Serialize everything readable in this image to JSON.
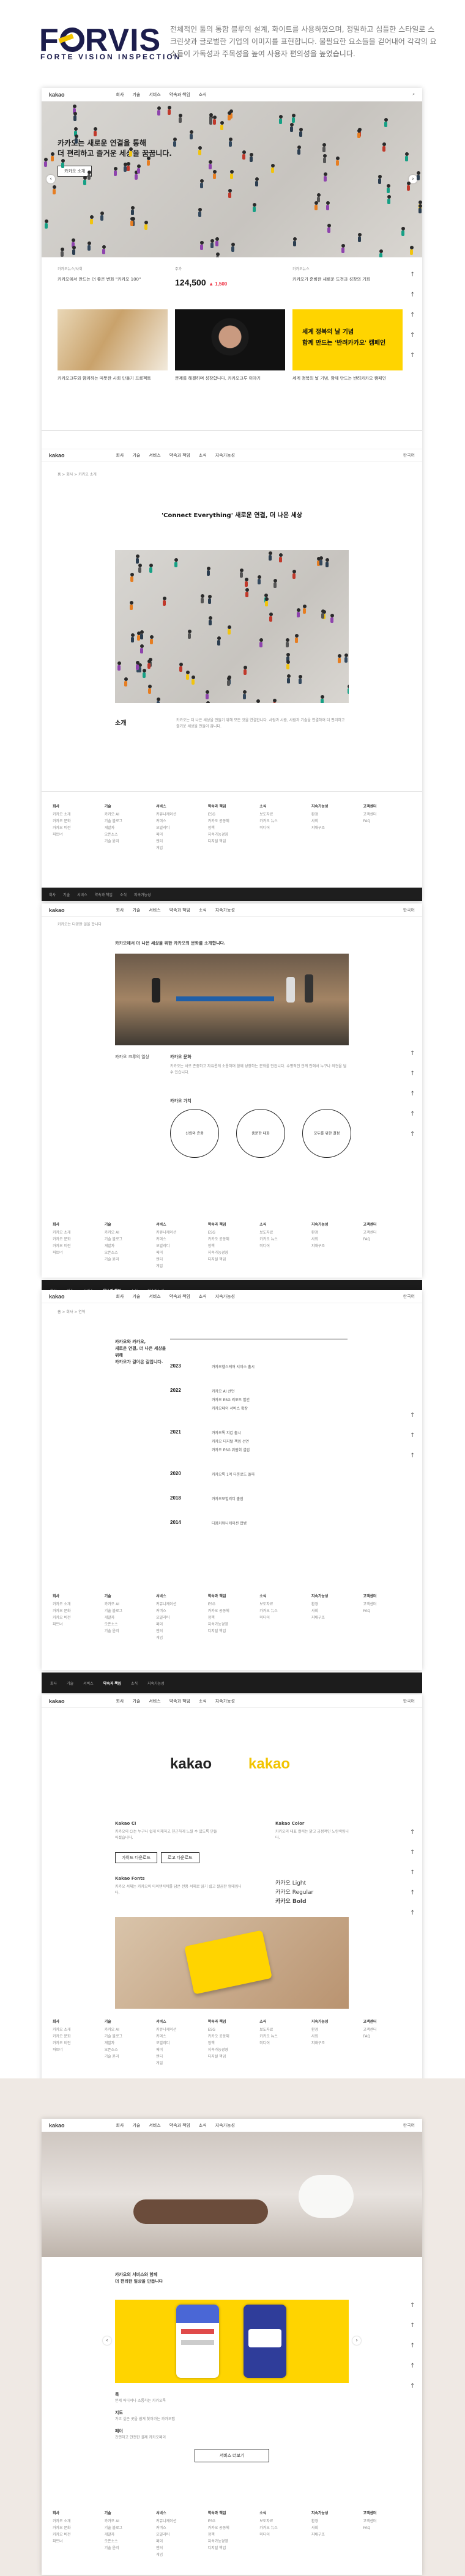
{
  "brand": {
    "name": "FORVIS",
    "tagline": "FORTE VISION INSPECTION"
  },
  "intro": "전체적인 툴의 통합 블루의 설계, 화이트를 사용하였으며, 정밀하고 심플한 스타일로 스크린샷과 글로벌한 기업의 이미지를 표현합니다. 불필요한 요소들을 걷어내어 각각의 요소들이 가독성과 주목성을 높여 사용자 편의성을 높였습니다.",
  "site": {
    "brand": "kakao",
    "nav": [
      "회사",
      "기술",
      "서비스",
      "약속과 책임",
      "소식"
    ],
    "nav_full": [
      "회사",
      "기술",
      "서비스",
      "약속과 책임",
      "소식",
      "지속가능성"
    ],
    "lang": "한국어",
    "hero_lines": [
      "카카오는 새로운 연결을 통해",
      "더 편리하고 즐거운 세상을 꿈꿉니다."
    ],
    "hero_btn": "카카오 소개",
    "news1_label": "카카오뉴스/사회",
    "news1_title": "카카오에서 만드는 더 좋은 변화 \"카카오 100\"",
    "stock_label": "주가",
    "stock_price": "124,500",
    "stock_change": "▲ 1,500",
    "news3_label": "카카오뉴스",
    "news3_title": "카카오가 준비한 새로운 도전과 성장의 기회",
    "yellow_lines": [
      "세계 정복의 날 기념",
      "함께 만드는 '반려카카오' 캠페인"
    ],
    "card_caption_1": "카카오크루와 함께하는 따뜻한 사회 만들기 프로젝트",
    "card_caption_2": "문제를 해결하며 성장합니다, 카카오크루 이야기",
    "card_caption_3": "세계 정복의 날 기념, 함께 만드는 반려카카오 캠페인",
    "side_icons": [
      "↑",
      "↑",
      "↑",
      "↑",
      "↑"
    ]
  },
  "about": {
    "breadcrumb": "홈 > 회사 > 카카오 소개",
    "heading": "'Connect Everything' 새로운 연결, 더 나은 세상",
    "label": "소개",
    "body": "카카오는 더 나은 세상을 만들기 위해 모든 것을 연결합니다. 사람과 사람, 사람과 기술을 연결하여 더 편리하고 즐거운 세상을 만들어 갑니다."
  },
  "footer": {
    "cols": [
      {
        "h": "회사",
        "items": [
          "카카오 소개",
          "카카오 문화",
          "카카오 비전",
          "파트너"
        ]
      },
      {
        "h": "기술",
        "items": [
          "카카오 AI",
          "기술 블로그",
          "개발자",
          "오픈소스",
          "기술 윤리"
        ]
      },
      {
        "h": "서비스",
        "items": [
          "커뮤니케이션",
          "커머스",
          "모빌리티",
          "페이",
          "엔터",
          "게임"
        ]
      },
      {
        "h": "약속과 책임",
        "items": [
          "ESG",
          "카카오 공동체",
          "정책",
          "지속가능경영",
          "디지털 책임"
        ]
      },
      {
        "h": "소식",
        "items": [
          "보도자료",
          "카카오 뉴스",
          "미디어"
        ]
      },
      {
        "h": "지속가능성",
        "items": [
          "환경",
          "사회",
          "지배구조"
        ]
      },
      {
        "h": "고객센터",
        "items": [
          "고객센터",
          "FAQ"
        ]
      }
    ]
  },
  "culture": {
    "breadcrumb": "카카오는 다양한 일을 합니다",
    "heading": "카카오에서 더 나은 세상을 위한 카카오의 문화를 소개합니다.",
    "photo_caption": "카카오 크루의 일상",
    "side_title": "카카오 문화",
    "body": "카카오는 서로 존중하고 자유롭게 소통하며 함께 성장하는 문화를 만듭니다. 수평적인 관계 안에서 누구나 의견을 낼 수 있습니다.",
    "values_title": "카카오 가치",
    "circles": [
      "신뢰와 존중",
      "충분한 대화",
      "모두를 위한 결정"
    ]
  },
  "history": {
    "breadcrumb": "홈 > 회사 > 연혁",
    "intro_lines": [
      "카카오와 카카오,",
      "새로운 연결, 더 나은 세상을 위해",
      "카카오가 걸어온 길입니다."
    ],
    "rows": [
      {
        "year": "2023",
        "items": [
          "카카오헬스케어 서비스 출시"
        ]
      },
      {
        "year": "2022",
        "items": [
          "카카오 AI 선언",
          "카카오 ESG 리포트 발간",
          "카카오페이 서비스 확장"
        ]
      },
      {
        "year": "2021",
        "items": [
          "카카오톡 지갑 출시",
          "카카오 디지털 책임 선언",
          "카카오 ESG 위원회 설립"
        ]
      },
      {
        "year": "2020",
        "items": [
          "카카오톡 1억 다운로드 돌파"
        ]
      },
      {
        "year": "2018",
        "items": [
          "카카오모빌리티 출범"
        ]
      },
      {
        "year": "2014",
        "items": [
          "다음커뮤니케이션 합병"
        ]
      }
    ]
  },
  "brandpage": {
    "logo_dark": "kakao",
    "logo_yellow": "kakao",
    "left_title": "Kakao CI",
    "left_body": "카카오의 CI는 누구나 쉽게 이해하고 친근하게 느낄 수 있도록 만들어졌습니다.",
    "btn1": "가이드 다운로드",
    "btn2": "로고 다운로드",
    "right_title": "Kakao Color",
    "right_body": "카카오의 대표 컬러는 밝고 긍정적인 노란색입니다.",
    "font_title": "Kakao Fonts",
    "font_body": "카카오 서체는 카카오의 아이덴티티를 담은 전용 서체로 읽기 쉽고 깔끔한 형태입니다.",
    "font_light": "카카오 Light",
    "font_regular": "카카오 Regular",
    "font_bold": "카카오 Bold",
    "yellow": "#FFD400"
  },
  "service": {
    "heading_lines": [
      "카카오의 서비스와 함께",
      "더 편리한 일상을 만듭니다"
    ],
    "cards": [
      {
        "title": "톡",
        "desc": "언제 어디서나 소통하는 카카오톡"
      },
      {
        "title": "지도",
        "desc": "가고 싶은 곳을 쉽게 찾아가는 카카오맵"
      },
      {
        "title": "페이",
        "desc": "간편하고 안전한 결제 카카오페이"
      }
    ],
    "more_btn": "서비스 더보기"
  },
  "colors": {
    "navy": "#1C1D4C",
    "yellow": "#FFD400",
    "dark": "#1E1E1E"
  }
}
